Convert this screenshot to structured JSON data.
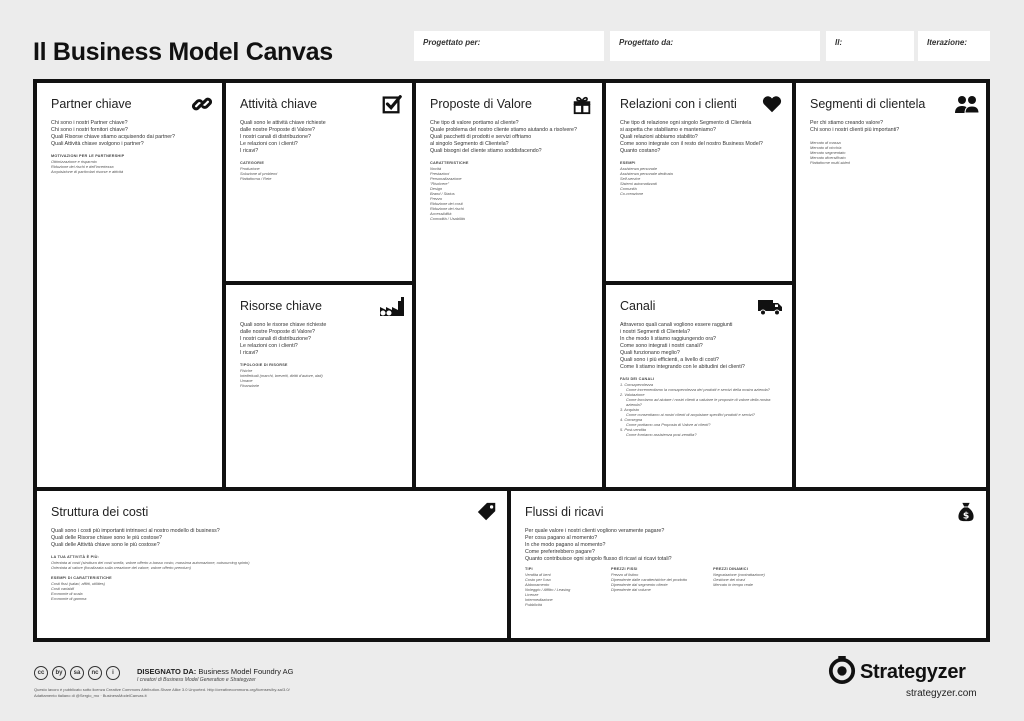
{
  "header": {
    "title": "Il Business Model Canvas",
    "designed_for_label": "Progettato per:",
    "designed_by_label": "Progettato da:",
    "date_label": "Il:",
    "iteration_label": "Iterazione:"
  },
  "cells": {
    "partners": {
      "title": "Partner chiave",
      "icon": "link-icon",
      "questions": [
        "Chi sono i nostri Partner chiave?",
        "Chi sono i nostri fornitori chiave?",
        "Quali Risorse chiave stiamo acquisendo dai partner?",
        "Quali Attività chiave svolgono i partner?"
      ],
      "sub_heading": "Motivazioni per le partnership",
      "items": [
        "Ottimizzazione e risparmio",
        "Riduzione dei rischi e dell'incertezza",
        "Acquisizione di particolari risorse e attività"
      ]
    },
    "activities": {
      "title": "Attività chiave",
      "icon": "checkbox-icon",
      "questions": [
        "Quali sono le attività chiave richieste",
        "dalle nostre Proposte di Valore?",
        "I nostri canali di distribuzione?",
        "Le relazioni con i clienti?",
        "I ricavi?"
      ],
      "sub_heading": "Categorie",
      "items": [
        "Produzione",
        "Soluzione di problemi",
        "Piattaforma / Rete"
      ]
    },
    "resources": {
      "title": "Risorse chiave",
      "icon": "factory-icon",
      "questions": [
        "Quali sono le risorse chiave richieste",
        "dalle nostre Proposte di Valore?",
        "I nostri canali di distribuzione?",
        "Le relazioni con i clienti?",
        "I ricavi?"
      ],
      "sub_heading": "Tipologie di risorse",
      "items": [
        "Fisiche",
        "Intellettuali (marchi, brevetti, diritti d'autore, dati)",
        "Umane",
        "Finanziarie"
      ]
    },
    "value": {
      "title": "Proposte di Valore",
      "icon": "gift-icon",
      "questions": [
        "Che tipo di valore portiamo al cliente?",
        "Quale problema del nostro cliente stiamo aiutando a risolvere?",
        "Quali pacchetti di prodotti e servizi offriamo",
        "al singolo Segmento di Clientela?",
        "Quali bisogni del cliente stiamo soddisfacendo?"
      ],
      "sub_heading": "Caratteristiche",
      "items": [
        "Novità",
        "Prestazioni",
        "Personalizzazione",
        "\"Risolvere\"",
        "Design",
        "Brand / Status",
        "Prezzo",
        "Riduzione dei costi",
        "Riduzione dei rischi",
        "Accessibilità",
        "Comodità / Usabilità"
      ]
    },
    "relationships": {
      "title": "Relazioni con i clienti",
      "icon": "heart-icon",
      "questions": [
        "Che tipo di relazione ogni singolo Segmento di Clientela",
        "si aspetta che stabiliamo e manteniamo?",
        "Quali relazioni abbiamo stabilito?",
        "Come sono integrate con il resto del nostro Business Model?",
        "Quanto costano?"
      ],
      "sub_heading": "Esempi",
      "items": [
        "Assistenza personale",
        "Assistenza personale dedicata",
        "Self-service",
        "Sistemi automatizzati",
        "Comunità",
        "Co-creazione"
      ]
    },
    "channels": {
      "title": "Canali",
      "icon": "truck-icon",
      "questions": [
        "Attraverso quali canali vogliono essere raggiunti",
        "i nostri Segmenti di Clientela?",
        "In che modo li stiamo raggiungendo ora?",
        "Come sono integrati i nostri canali?",
        "Quali funzionano meglio?",
        "Quali sono i più efficienti, a livello di costi?",
        "Come li stiamo integrando con le abitudini dei clienti?"
      ],
      "sub_heading": "Fasi dei canali",
      "items": [
        "1. Consapevolezza",
        "Come incrementiamo la consapevolezza dei prodotti e servizi della nostra azienda?",
        "2. Valutazione",
        "Come facciamo ad aiutare i nostri clienti a valutare le proposte di valore della nostra azienda?",
        "3. Acquisto",
        "Come consentiamo ai nostri clienti di acquistare specifici prodotti e servizi?",
        "4. Consegna",
        "Come portiamo una Proposta di Valore ai clienti?",
        "5. Post-vendita",
        "Come forniamo assistenza post-vendita?"
      ]
    },
    "segments": {
      "title": "Segmenti di clientela",
      "icon": "people-icon",
      "questions": [
        "Per chi stiamo creando valore?",
        "Chi sono i nostri clienti più importanti?"
      ],
      "items": [
        "Mercato di massa",
        "Mercato di nicchia",
        "Mercato segmentato",
        "Mercato diversificato",
        "Piattaforme multi-sided"
      ]
    },
    "costs": {
      "title": "Struttura dei costi",
      "icon": "tag-icon",
      "questions": [
        "Quali sono i costi più importanti intrinseci al nostro modello di business?",
        "Quali delle Risorse chiave sono le più costose?",
        "Quali delle Attività chiave sono le più costose?"
      ],
      "sub_heading_1": "La tua attività è più:",
      "items_1": [
        "Orientata ai costi (struttura dei costi snella, valore offerto a basso costo, massima automazione, outsourcing spinto)",
        "Orientata al valore (focalizzata sulla creazione del valore, valore offerto premium)"
      ],
      "sub_heading_2": "Esempi di caratteristiche",
      "items_2": [
        "Costi fissi (salari, affitti, utilities)",
        "Costi variabili",
        "Economie di scala",
        "Economie di gamma"
      ]
    },
    "revenue": {
      "title": "Flussi di ricavi",
      "icon": "money-bag-icon",
      "questions": [
        "Per quale valore i nostri clienti vogliono veramente pagare?",
        "Per cosa pagano al momento?",
        "In che modo pagano al momento?",
        "Come preferirebbero pagare?",
        "Quanto contribuisce ogni singolo flusso di ricavi ai ricavi totali?"
      ],
      "col1_heading": "Tipi",
      "col1_items": [
        "Vendita di beni",
        "Costo per l'uso",
        "Abbonamento",
        "Noleggio / Affitto / Leasing",
        "Licenze",
        "Intermediazione",
        "Pubblicità"
      ],
      "col2_heading": "Prezzi fissi",
      "col2_items": [
        "Prezzo di listino",
        "Dipendente dalle caratteristiche del prodotto",
        "Dipendente dal segmento cliente",
        "Dipendente dal volume"
      ],
      "col3_heading": "Prezzi dinamici",
      "col3_items": [
        "Negoziazione (contrattazione)",
        "Gestione dei ricavi",
        "Mercato in tempo reale"
      ]
    }
  },
  "footer": {
    "cc_icons": [
      "cc",
      "by",
      "sa",
      "nc",
      "i"
    ],
    "designed_by_label": "DISEGNATO DA:",
    "designed_by_name": "Business Model Foundry AG",
    "designed_by_sub": "I creatori di Business Model Generation e Strategyzer",
    "license_line_1": "Questo lavoro è pubblicato sotto licenza Creative Commons Attribution-Share Alike 3.0 Unported. http://creativecommons.org/licenses/by-sa/3.0/",
    "license_line_2": "Adattamento italiano di @Sergio_mo · BusinessModelCanvas.it",
    "brand_name": "Strategyzer",
    "brand_url": "strategyzer.com"
  }
}
